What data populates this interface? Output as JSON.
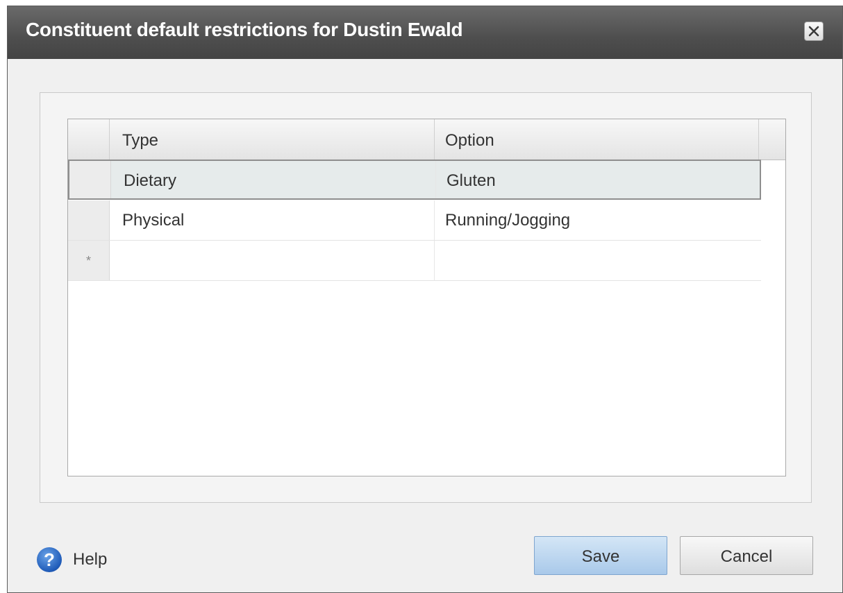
{
  "dialog": {
    "title": "Constituent default restrictions for Dustin Ewald"
  },
  "grid": {
    "columns": [
      "Type",
      "Option"
    ],
    "rows": [
      {
        "type": "Dietary",
        "option": "Gluten"
      },
      {
        "type": "Physical",
        "option": "Running/Jogging"
      }
    ],
    "new_row_marker": "*"
  },
  "footer": {
    "help_label": "Help",
    "save_label": "Save",
    "cancel_label": "Cancel"
  },
  "icons": {
    "close": "close-icon",
    "help": "help-icon"
  }
}
